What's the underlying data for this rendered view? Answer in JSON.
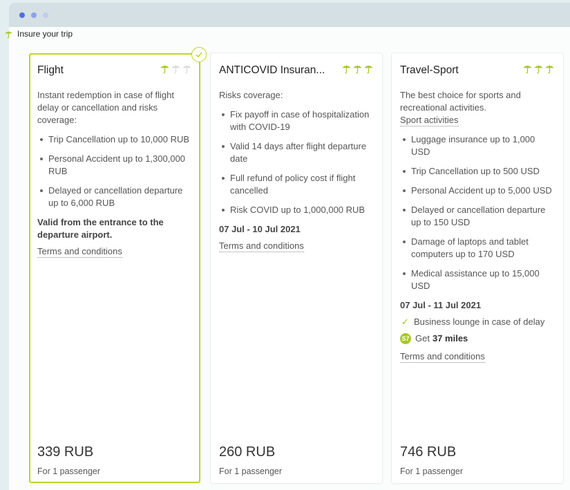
{
  "header": {
    "title": "Insure your trip"
  },
  "cards": [
    {
      "title": "Flight",
      "rating": 1,
      "intro": "Instant redemption in case of flight delay or cancellation and risks coverage:",
      "bullets": [
        "Trip Cancellation up to 10,000 RUB",
        "Personal Accident up to 1,300,000 RUB",
        "Delayed or cancellation departure up to 6,000 RUB"
      ],
      "valid": "Valid from the entrance to the departure airport.",
      "terms": "Terms and conditions",
      "price": "339 RUB",
      "passengers": "For 1 passenger"
    },
    {
      "title": "ANTICOVID Insuran...",
      "rating": 3,
      "intro": "Risks coverage:",
      "bullets": [
        "Fix payoff in case of hospitalization with COVID-19",
        "Valid 14 days after flight departure date",
        "Full refund of policy cost if flight cancelled",
        "Risk COVID up to 1,000,000 RUB"
      ],
      "dates": "07 Jul - 10 Jul 2021",
      "terms": "Terms and conditions",
      "price": "260 RUB",
      "passengers": "For 1 passenger"
    },
    {
      "title": "Travel-Sport",
      "rating": 3,
      "intro": "The best choice for sports and recreational activities.",
      "sport_link": "Sport activities",
      "bullets": [
        "Luggage insurance up to 1,000 USD",
        "Trip Cancellation up to 500 USD",
        "Personal Accident up to 5,000 USD",
        "Delayed or cancellation departure up to 150 USD",
        "Damage of laptops and tablet computers up to 170 USD",
        "Medical assistance up to 15,000 USD"
      ],
      "dates": "07 Jul - 11 Jul 2021",
      "feature": "Business lounge in case of delay",
      "miles_prefix": "Get",
      "miles_value": "37 miles",
      "s7_label": "S7",
      "terms": "Terms and conditions",
      "price": "746 RUB",
      "passengers": "For 1 passenger"
    }
  ],
  "colors": {
    "accent": "#bdd61f",
    "umbrella_on": "#a6c82a",
    "umbrella_off": "#d8dcdd"
  },
  "icons": {
    "umbrella": "umbrella-icon",
    "check": "checkmark-icon"
  }
}
